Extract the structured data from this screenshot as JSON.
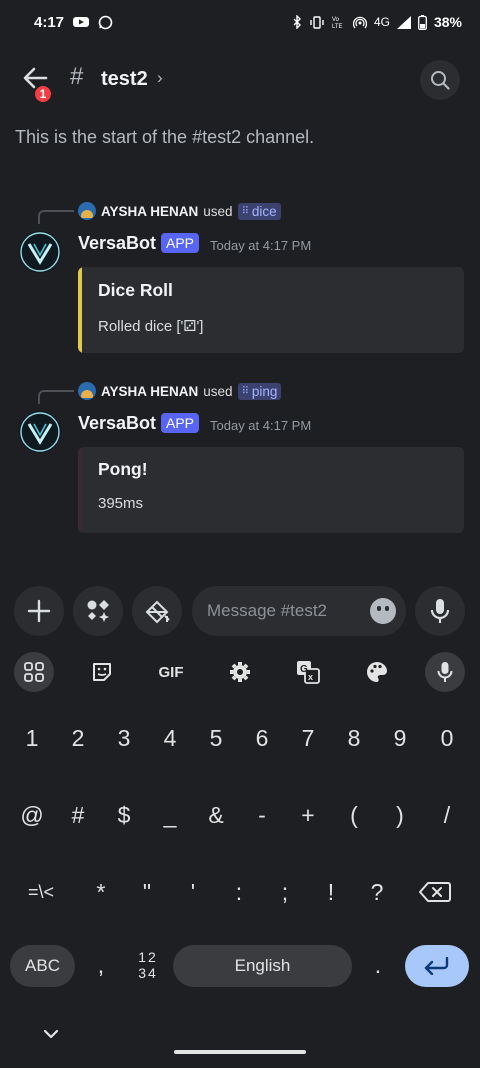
{
  "status_bar": {
    "time": "4:17",
    "network": "4G",
    "battery": "38%"
  },
  "header": {
    "back_badge": "1",
    "hash": "#",
    "channel": "test2",
    "chevron": "›"
  },
  "channel_start": "This is the start of the #test2 channel.",
  "messages": [
    {
      "user": "AYSHA HENAN",
      "used": "used",
      "command": "dice",
      "bot": "VersaBot",
      "tag": "APP",
      "time": "Today at 4:17 PM",
      "embed": {
        "title": "Dice Roll",
        "desc": "Rolled dice ['⚂']",
        "bar_color": "#e3c84a"
      }
    },
    {
      "user": "AYSHA HENAN",
      "used": "used",
      "command": "ping",
      "bot": "VersaBot",
      "tag": "APP",
      "time": "Today at 4:17 PM",
      "embed": {
        "title": "Pong!",
        "desc": "395ms",
        "bar_color": "#3a2b30"
      }
    }
  ],
  "composer": {
    "placeholder": "Message #test2"
  },
  "keyboard": {
    "toolbar": {
      "gif": "GIF"
    },
    "row1": [
      "1",
      "2",
      "3",
      "4",
      "5",
      "6",
      "7",
      "8",
      "9",
      "0"
    ],
    "row2": [
      "@",
      "#",
      "$",
      "_",
      "&",
      "-",
      "+",
      "(",
      ")",
      "/"
    ],
    "row3": [
      "=\\<",
      "*",
      "\"",
      "'",
      ":",
      ";",
      "!",
      "?"
    ],
    "abc": "ABC",
    "comma": ",",
    "symnum_top": "12",
    "symnum_bottom": "34",
    "space": "English",
    "period": "."
  },
  "icons": [
    "back-arrow-icon",
    "search-icon",
    "plus-icon",
    "apps-icon",
    "gift-icon",
    "emoji-icon",
    "mic-icon",
    "grid-icon",
    "sticker-icon",
    "settings-icon",
    "translate-icon",
    "palette-icon",
    "backspace-icon",
    "enter-icon"
  ]
}
